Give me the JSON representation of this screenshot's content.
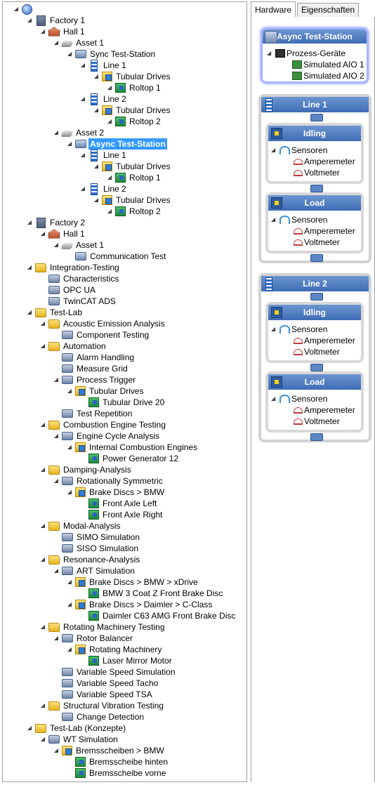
{
  "tree": {
    "rows": [
      {
        "label": "",
        "icon": "globe",
        "indent": 0
      },
      {
        "label": "Factory 1",
        "icon": "factory",
        "indent": 1
      },
      {
        "label": "Hall 1",
        "icon": "hall",
        "indent": 2
      },
      {
        "label": "Asset 1",
        "icon": "asset",
        "indent": 3
      },
      {
        "label": "Sync Test-Station",
        "icon": "station",
        "indent": 4
      },
      {
        "label": "Line 1",
        "icon": "line",
        "indent": 5
      },
      {
        "label": "Tubular Drives",
        "icon": "group",
        "indent": 6
      },
      {
        "label": "Roltop 1",
        "icon": "drive",
        "indent": 7
      },
      {
        "label": "Line 2",
        "icon": "line",
        "indent": 5
      },
      {
        "label": "Tubular Drives",
        "icon": "group",
        "indent": 6
      },
      {
        "label": "Roltop 2",
        "icon": "drive",
        "indent": 7
      },
      {
        "label": "Asset 2",
        "icon": "asset",
        "indent": 3
      },
      {
        "label": "Async Test-Station",
        "icon": "station",
        "indent": 4,
        "selected": true
      },
      {
        "label": "Line 1",
        "icon": "line",
        "indent": 5
      },
      {
        "label": "Tubular Drives",
        "icon": "group",
        "indent": 6
      },
      {
        "label": "Roltop 1",
        "icon": "drive",
        "indent": 7
      },
      {
        "label": "Line 2",
        "icon": "line",
        "indent": 5
      },
      {
        "label": "Tubular Drives",
        "icon": "group",
        "indent": 6
      },
      {
        "label": "Roltop 2",
        "icon": "drive",
        "indent": 7
      },
      {
        "label": "Factory 2",
        "icon": "factory",
        "indent": 1
      },
      {
        "label": "Hall 1",
        "icon": "hall",
        "indent": 2
      },
      {
        "label": "Asset 1",
        "icon": "asset",
        "indent": 3
      },
      {
        "label": "Communication Test",
        "icon": "station",
        "indent": 4,
        "leaf": true
      },
      {
        "label": "Integration-Testing",
        "icon": "folder",
        "indent": 1
      },
      {
        "label": "Characteristics",
        "icon": "test",
        "indent": 2,
        "leaf": true
      },
      {
        "label": "OPC UA",
        "icon": "test",
        "indent": 2,
        "leaf": true
      },
      {
        "label": "TwinCAT ADS",
        "icon": "test",
        "indent": 2,
        "leaf": true
      },
      {
        "label": "Test-Lab",
        "icon": "folder",
        "indent": 1
      },
      {
        "label": "Acoustic Emission Analysis",
        "icon": "folder",
        "indent": 2
      },
      {
        "label": "Component Testing",
        "icon": "test",
        "indent": 3,
        "leaf": true
      },
      {
        "label": "Automation",
        "icon": "folder",
        "indent": 2
      },
      {
        "label": "Alarm Handling",
        "icon": "test",
        "indent": 3,
        "leaf": true
      },
      {
        "label": "Measure Grid",
        "icon": "test",
        "indent": 3,
        "leaf": true
      },
      {
        "label": "Process Trigger",
        "icon": "test",
        "indent": 3
      },
      {
        "label": "Tubular Drives",
        "icon": "group",
        "indent": 4
      },
      {
        "label": "Tubular Drive 20",
        "icon": "drive",
        "indent": 5,
        "leaf": true
      },
      {
        "label": "Test Repetition",
        "icon": "test",
        "indent": 3,
        "leaf": true
      },
      {
        "label": "Combustion Engine Testing",
        "icon": "folder",
        "indent": 2
      },
      {
        "label": "Engine Cycle Analysis",
        "icon": "test",
        "indent": 3
      },
      {
        "label": "Internal Combustion Engines",
        "icon": "group",
        "indent": 4
      },
      {
        "label": "Power Generator 12",
        "icon": "drive",
        "indent": 5,
        "leaf": true
      },
      {
        "label": "Damping-Analysis",
        "icon": "folder",
        "indent": 2
      },
      {
        "label": "Rotationally Symmetric",
        "icon": "test",
        "indent": 3
      },
      {
        "label": "Brake Discs > BMW",
        "icon": "group",
        "indent": 4
      },
      {
        "label": "Front Axle Left",
        "icon": "drive",
        "indent": 5,
        "leaf": true
      },
      {
        "label": "Front Axle Right",
        "icon": "drive",
        "indent": 5,
        "leaf": true
      },
      {
        "label": "Modal-Analysis",
        "icon": "folder",
        "indent": 2
      },
      {
        "label": "SIMO Simulation",
        "icon": "test",
        "indent": 3,
        "leaf": true
      },
      {
        "label": "SISO Simulation",
        "icon": "test",
        "indent": 3,
        "leaf": true
      },
      {
        "label": "Resonance-Analysis",
        "icon": "folder",
        "indent": 2
      },
      {
        "label": "ART Simulation",
        "icon": "test",
        "indent": 3
      },
      {
        "label": "Brake Discs > BMW > xDrive",
        "icon": "group",
        "indent": 4
      },
      {
        "label": "BMW 3 Coat Z Front Brake Disc",
        "icon": "drive",
        "indent": 5,
        "leaf": true
      },
      {
        "label": "Brake Discs > Daimler > C-Class",
        "icon": "group",
        "indent": 4
      },
      {
        "label": "Daimler C63 AMG Front Brake Disc",
        "icon": "drive",
        "indent": 5,
        "leaf": true
      },
      {
        "label": "Rotating Machinery Testing",
        "icon": "folder",
        "indent": 2
      },
      {
        "label": "Rotor Balancer",
        "icon": "test",
        "indent": 3
      },
      {
        "label": "Rotating Machinery",
        "icon": "group",
        "indent": 4
      },
      {
        "label": "Laser Mirror Motor",
        "icon": "drive",
        "indent": 5,
        "leaf": true
      },
      {
        "label": "Variable Speed Simulation",
        "icon": "test",
        "indent": 3,
        "leaf": true
      },
      {
        "label": "Variable Speed Tacho",
        "icon": "test",
        "indent": 3,
        "leaf": true
      },
      {
        "label": "Variable Speed TSA",
        "icon": "test",
        "indent": 3,
        "leaf": true
      },
      {
        "label": "Structural Vibration Testing",
        "icon": "folder",
        "indent": 2
      },
      {
        "label": "Change Detection",
        "icon": "test",
        "indent": 3,
        "leaf": true
      },
      {
        "label": "Test-Lab (Konzepte)",
        "icon": "folder",
        "indent": 1
      },
      {
        "label": "WT Simulation",
        "icon": "test",
        "indent": 2
      },
      {
        "label": "Bremsscheiben > BMW",
        "icon": "group",
        "indent": 3
      },
      {
        "label": "Bremsscheibe hinten",
        "icon": "drive",
        "indent": 4,
        "leaf": true
      },
      {
        "label": "Bremsscheibe vorne",
        "icon": "drive",
        "indent": 4,
        "leaf": true
      }
    ]
  },
  "tabs": {
    "hardware": "Hardware",
    "eigenschaften": "Eigenschaften"
  },
  "station": {
    "title": "Async Test-Station",
    "group": "Prozess-Geräte",
    "devices": [
      "Simulated AIO 1",
      "Simulated AIO 2"
    ]
  },
  "lines": [
    {
      "title": "Line 1",
      "states": [
        {
          "title": "Idling",
          "sensors": "Sensoren",
          "meters": [
            "Amperemeter",
            "Voltmeter"
          ]
        },
        {
          "title": "Load",
          "sensors": "Sensoren",
          "meters": [
            "Amperemeter",
            "Voltmeter"
          ]
        }
      ]
    },
    {
      "title": "Line 2",
      "states": [
        {
          "title": "Idling",
          "sensors": "Sensoren",
          "meters": [
            "Amperemeter",
            "Voltmeter"
          ]
        },
        {
          "title": "Load",
          "sensors": "Sensoren",
          "meters": [
            "Amperemeter",
            "Voltmeter"
          ]
        }
      ]
    }
  ],
  "colors": {
    "header": "#4a78bf",
    "selection": "#3399ff",
    "station_glow": "#a8b4ff"
  }
}
